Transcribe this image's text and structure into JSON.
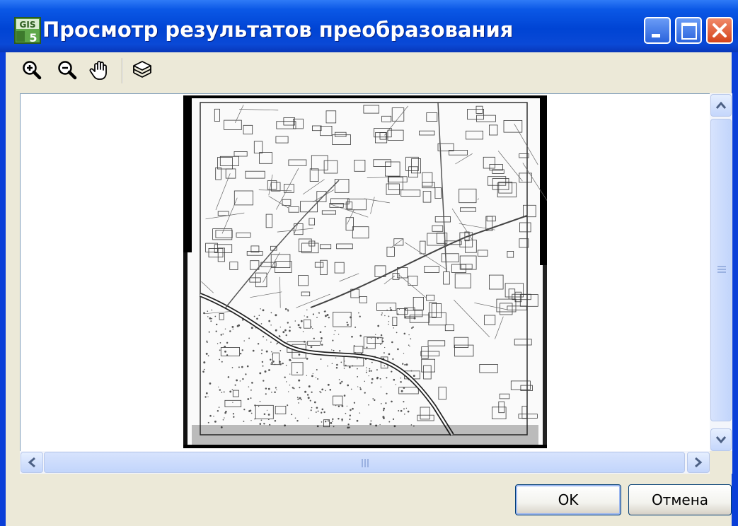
{
  "window": {
    "title": "Просмотр результатов преобразования",
    "app_icon": "gis5-app-icon",
    "controls": [
      "minimize-icon",
      "maximize-icon",
      "close-icon"
    ]
  },
  "toolbar": {
    "tools": [
      {
        "name": "zoom-in",
        "icon": "zoom-in-icon"
      },
      {
        "name": "zoom-out",
        "icon": "zoom-out-icon"
      },
      {
        "name": "pan",
        "icon": "hand-pan-icon"
      },
      {
        "name": "layers",
        "icon": "layers-icon"
      }
    ]
  },
  "preview": {
    "content": "scanned-topographic-map-sheet",
    "vertical_scroll_position": 0.0,
    "horizontal_scroll_position": 0.0
  },
  "buttons": {
    "ok": "OK",
    "cancel": "Отмена"
  },
  "colors": {
    "title_bar": "#0a49d6",
    "dialog_background": "#ece9d8",
    "close_button": "#d5441c",
    "scrollbar": "#c2d5fb"
  }
}
